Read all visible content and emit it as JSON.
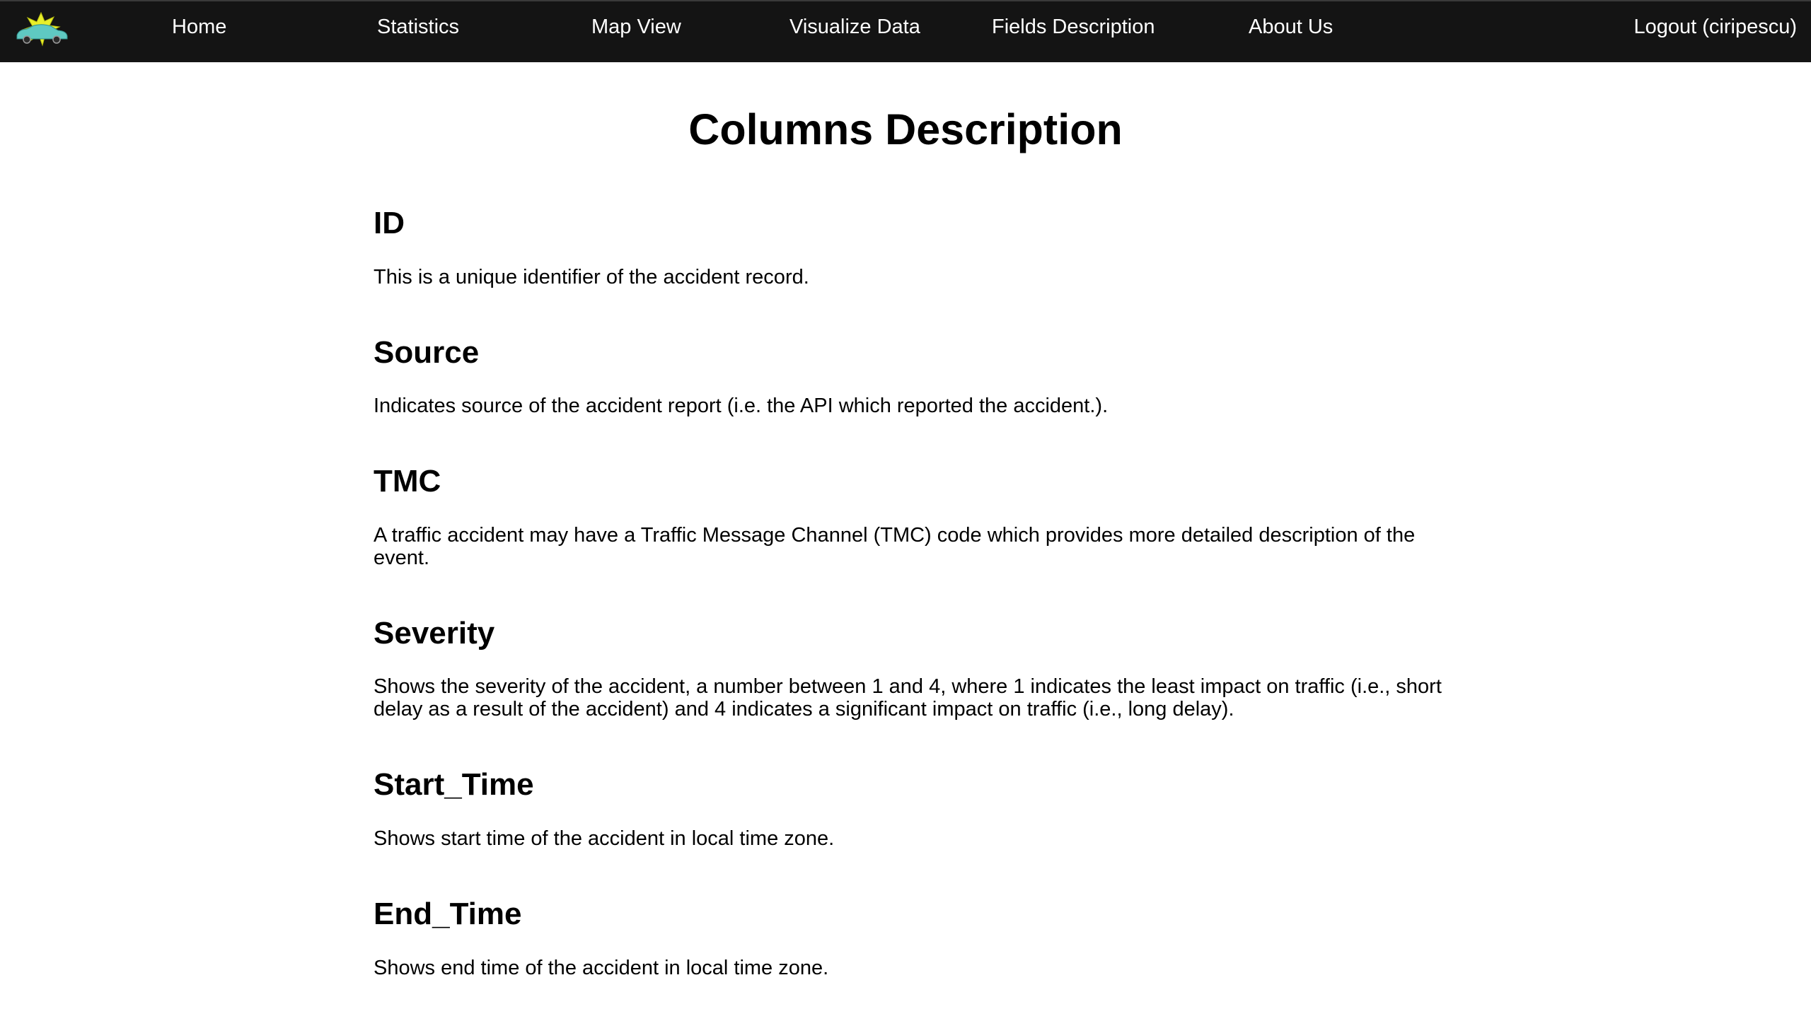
{
  "nav": {
    "logo_icon": "car-crash-logo-icon",
    "links": [
      "Home",
      "Statistics",
      "Map View",
      "Visualize Data",
      "Fields Description",
      "About Us"
    ],
    "logout": "Logout (ciripescu)"
  },
  "page": {
    "title": "Columns Description",
    "fields": [
      {
        "name": "ID",
        "description": "This is a unique identifier of the accident record."
      },
      {
        "name": "Source",
        "description": "Indicates source of the accident report (i.e. the API which reported the accident.)."
      },
      {
        "name": "TMC",
        "description": "A traffic accident may have a Traffic Message Channel (TMC) code which provides more detailed description of the event."
      },
      {
        "name": "Severity",
        "description": "Shows the severity of the accident, a number between 1 and 4, where 1 indicates the least impact on traffic (i.e., short delay as a result of the accident) and 4 indicates a significant impact on traffic (i.e., long delay)."
      },
      {
        "name": "Start_Time",
        "description": "Shows start time of the accident in local time zone."
      },
      {
        "name": "End_Time",
        "description": "Shows end time of the accident in local time zone."
      }
    ]
  },
  "colors": {
    "navbar_bg": "#141414",
    "nav_text": "#ffffff",
    "page_bg": "#ffffff",
    "text": "#000000",
    "logo_yellow": "#e8ef2a",
    "logo_teal": "#5fc9c2"
  }
}
